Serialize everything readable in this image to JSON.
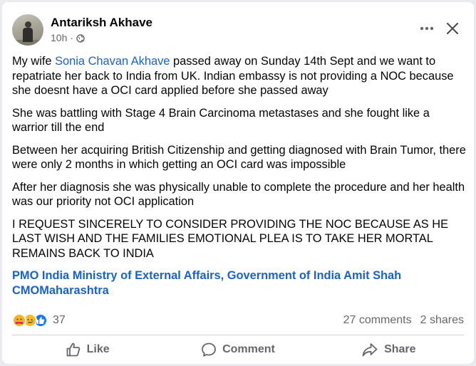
{
  "post": {
    "author": "Antariksh Akhave",
    "time": "10h",
    "separator": "·",
    "paragraphs": [
      {
        "before": "My wife ",
        "mention": "Sonia Chavan Akhave",
        "after": " passed away on Sunday 14th Sept and we want to repatriate her back to India from UK. Indian embassy is not providing a NOC because she doesnt have a OCI card applied before she passed away"
      },
      {
        "text": "She was battling with Stage 4 Brain Carcinoma metastases and she fought like a warrior till the end"
      },
      {
        "text": "Between her acquiring British Citizenship and getting diagnosed with Brain Tumor, there were only 2 months in which getting an OCI card was impossible"
      },
      {
        "text": "After her diagnosis she was physically unable to complete the procedure and her health was our priority not OCI application"
      },
      {
        "text": "I REQUEST SINCERELY TO CONSIDER PROVIDING THE NOC BECAUSE AS HE LAST WISH AND THE FAMILIES EMOTIONAL PLEA IS TO TAKE HER MORTAL REMAINS BACK TO INDIA"
      }
    ],
    "tags": [
      "PMO India",
      "Ministry of External Affairs, Government of India",
      "Amit Shah",
      "CMOMaharashtra"
    ]
  },
  "reactions": {
    "icons": [
      "care-icon",
      "sad-icon",
      "like-icon"
    ],
    "count": "37",
    "comments": "27 comments",
    "shares": "2 shares"
  },
  "actions": {
    "like": "Like",
    "comment": "Comment",
    "share": "Share"
  },
  "colors": {
    "link": "#1b62c8",
    "secondary_text": "#65676b",
    "like_blue": "#1877f2"
  }
}
